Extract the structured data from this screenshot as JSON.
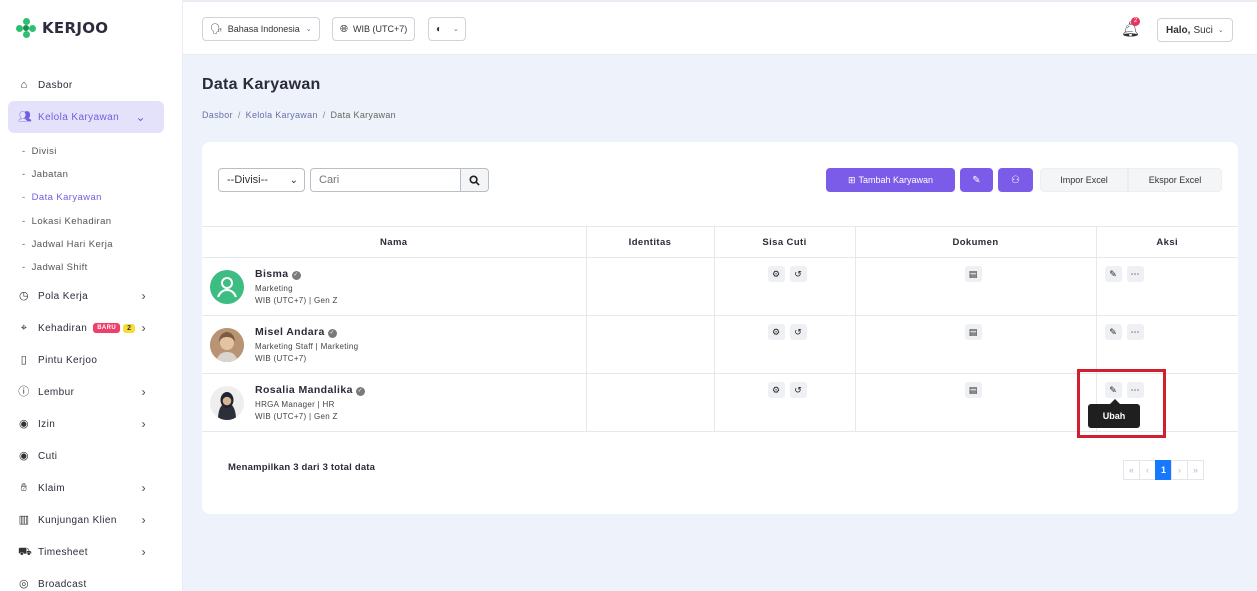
{
  "app": {
    "name": "KERJOO"
  },
  "colors": {
    "accent": "#7b5ce9",
    "sidebar_active_bg": "#e4e2fb",
    "page_bg": "#eef3fb",
    "highlight": "#d21f2f",
    "pager_active": "#1677ff"
  },
  "topbar": {
    "language": "Bahasa Indonesia",
    "timezone": "WIB (UTC+7)",
    "notification_count": "2",
    "greeting": "Halo,",
    "user_name": "Suci"
  },
  "sidebar": {
    "items": [
      {
        "label": "Dasbor",
        "icon": "home-icon"
      },
      {
        "label": "Kelola Karyawan",
        "icon": "users-icon"
      },
      {
        "label": "Pola Kerja",
        "icon": "clock-icon"
      },
      {
        "label": "Kehadiran",
        "icon": "location-pin-icon",
        "badge": "BARU",
        "badge2": "2"
      },
      {
        "label": "Pintu Kerjoo",
        "icon": "door-icon"
      },
      {
        "label": "Lembur",
        "icon": "info-circle-icon"
      },
      {
        "label": "Izin",
        "icon": "circle-dot-icon"
      },
      {
        "label": "Cuti",
        "icon": "circle-dot-icon"
      },
      {
        "label": "Klaim",
        "icon": "hand-money-icon"
      },
      {
        "label": "Kunjungan Klien",
        "icon": "building-icon"
      },
      {
        "label": "Timesheet",
        "icon": "truck-icon"
      },
      {
        "label": "Broadcast",
        "icon": "broadcast-icon"
      }
    ],
    "sub_items": [
      {
        "label": "Divisi"
      },
      {
        "label": "Jabatan"
      },
      {
        "label": "Data Karyawan"
      },
      {
        "label": "Lokasi Kehadiran"
      },
      {
        "label": "Jadwal Hari Kerja"
      },
      {
        "label": "Jadwal Shift"
      }
    ]
  },
  "page": {
    "title": "Data Karyawan",
    "breadcrumb": [
      "Dasbor",
      "Kelola Karyawan",
      "Data Karyawan"
    ]
  },
  "toolbar": {
    "division_select": "--Divisi--",
    "search_placeholder": "Cari",
    "add_employee": "Tambah Karyawan",
    "import_excel": "Impor Excel",
    "export_excel": "Ekspor Excel"
  },
  "table": {
    "columns": [
      "Nama",
      "Identitas",
      "Sisa Cuti",
      "Dokumen",
      "Aksi"
    ],
    "rows": [
      {
        "name": "Bisma",
        "line1": "Marketing",
        "line2": "WIB (UTC+7) | Gen Z"
      },
      {
        "name": "Misel Andara",
        "line1": "Marketing Staff | Marketing",
        "line2": "WIB (UTC+7)"
      },
      {
        "name": "Rosalia Mandalika",
        "line1": "HRGA Manager | HR",
        "line2": "WIB (UTC+7) | Gen Z"
      }
    ]
  },
  "tooltip": {
    "text": "Ubah"
  },
  "footer": {
    "summary": "Menampilkan 3 dari 3 total data",
    "pager": [
      "«",
      "‹",
      "1",
      "›",
      "»"
    ]
  }
}
